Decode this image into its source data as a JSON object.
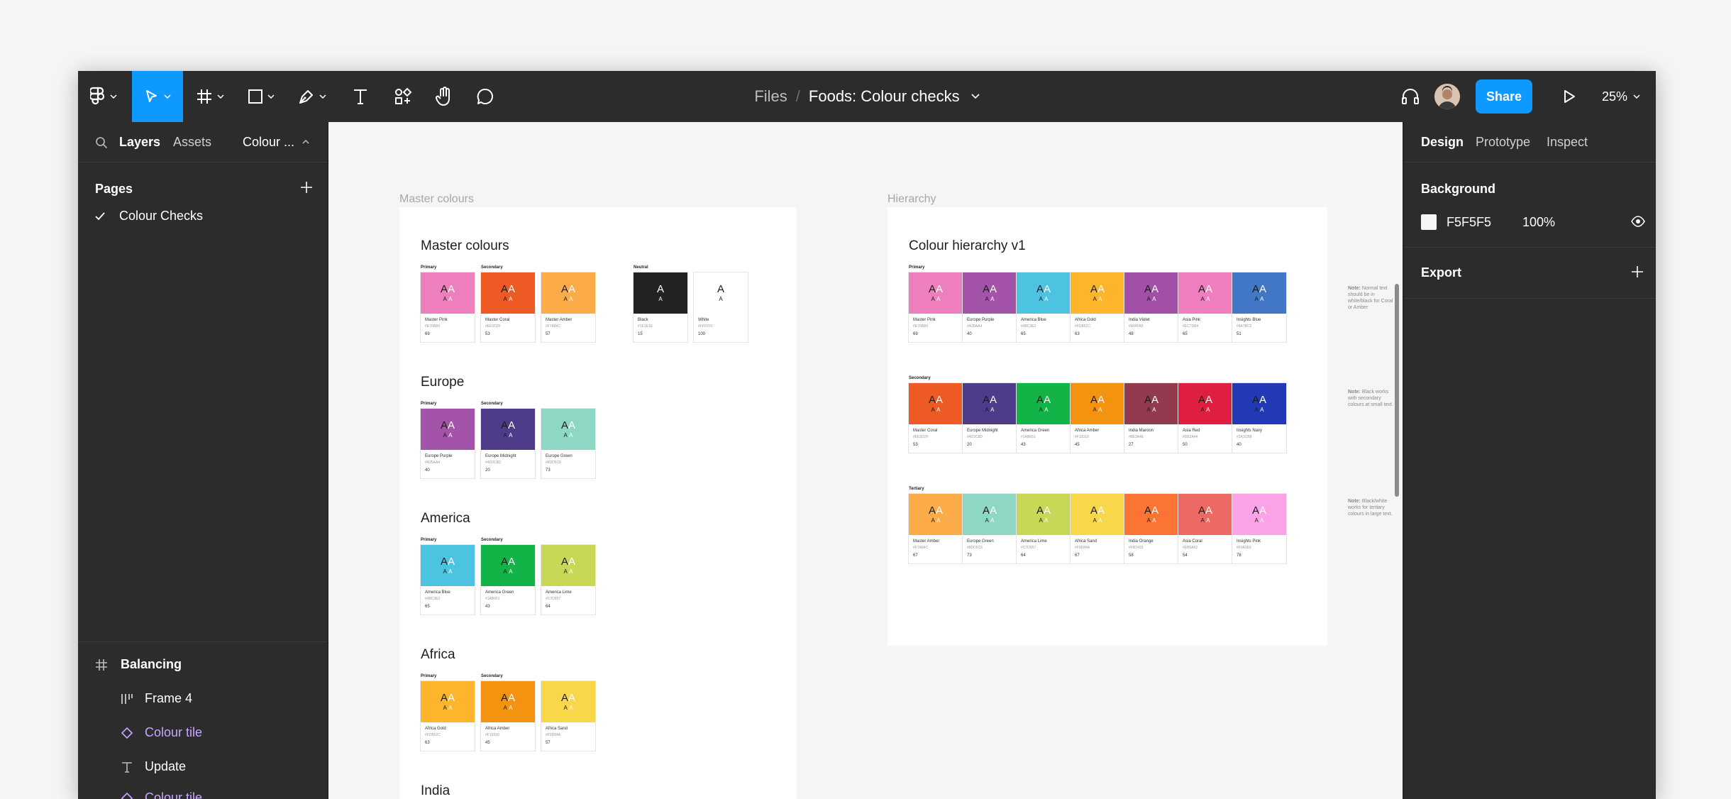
{
  "toolbar": {
    "breadcrumb_files": "Files",
    "breadcrumb_sep": "/",
    "file_name": "Foods: Colour checks",
    "share_label": "Share",
    "zoom": "25%"
  },
  "left_panel": {
    "tab_layers": "Layers",
    "tab_assets": "Assets",
    "page_selector": "Colour ...",
    "pages_header": "Pages",
    "pages": [
      "Colour Checks"
    ],
    "layers": [
      {
        "label": "Balancing",
        "kind": "frame"
      },
      {
        "label": "Frame 4",
        "kind": "autolayout"
      },
      {
        "label": "Colour tile",
        "kind": "component"
      },
      {
        "label": "Update",
        "kind": "text"
      },
      {
        "label": "Colour tile",
        "kind": "component"
      }
    ]
  },
  "right_panel": {
    "tab_design": "Design",
    "tab_prototype": "Prototype",
    "tab_inspect": "Inspect",
    "background_label": "Background",
    "background_hex": "F5F5F5",
    "background_opacity": "100%",
    "export_label": "Export"
  },
  "canvas": {
    "frame1_label": "Master colours",
    "frame2_label": "Hierarchy",
    "master": {
      "title": "Master colours",
      "primary_label": "Primary",
      "secondary_label": "Secondary",
      "neutral_label": "Neutral",
      "tiles": [
        {
          "name": "Master Pink",
          "hex": "#E76BB0",
          "score": "69",
          "color": "#ee7fbd"
        },
        {
          "name": "Master Coral",
          "hex": "#EE5D2F",
          "score": "53",
          "color": "#ee5a24"
        },
        {
          "name": "Master Amber",
          "hex": "#F7A84C",
          "score": "57",
          "color": "#fbab48"
        }
      ],
      "neutral": [
        {
          "name": "Black",
          "hex": "#1E1E1E",
          "score": "15",
          "color": "#222222",
          "a": "A"
        },
        {
          "name": "White",
          "hex": "#FFFFFF",
          "score": "100",
          "color": "#ffffff",
          "a": "A"
        }
      ]
    },
    "europe": {
      "title": "Europe",
      "primary_label": "Primary",
      "secondary_label": "Secondary",
      "tiles": [
        {
          "name": "Europe Purple",
          "hex": "#A35AA4",
          "score": "40",
          "color": "#a354a8"
        },
        {
          "name": "Europe Midnight",
          "hex": "#4D3C8D",
          "score": "20",
          "color": "#4e3b8a"
        },
        {
          "name": "Europe Green",
          "hex": "#8DD5C6",
          "score": "73",
          "color": "#8fd7c5"
        }
      ]
    },
    "america": {
      "title": "America",
      "primary_label": "Primary",
      "secondary_label": "Secondary",
      "tiles": [
        {
          "name": "America Blue",
          "hex": "#4BC3E2",
          "score": "65",
          "color": "#4cc4e1"
        },
        {
          "name": "America Green",
          "hex": "#1AB651",
          "score": "43",
          "color": "#12b447"
        },
        {
          "name": "America Lime",
          "hex": "#C7D957",
          "score": "64",
          "color": "#c8d856"
        }
      ]
    },
    "africa": {
      "title": "Africa",
      "primary_label": "Primary",
      "secondary_label": "Secondary",
      "tiles": [
        {
          "name": "Africa Gold",
          "hex": "#FDB52C",
          "score": "63",
          "color": "#fdb62c"
        },
        {
          "name": "Africa Amber",
          "hex": "#F19318",
          "score": "45",
          "color": "#f39310"
        },
        {
          "name": "Africa Sand",
          "hex": "#F9D84A",
          "score": "57",
          "color": "#f8d84a"
        }
      ]
    },
    "india": {
      "title": "India"
    },
    "hierarchy": {
      "title": "Colour hierarchy v1",
      "rows": [
        {
          "label": "Primary",
          "tiles": [
            {
              "name": "Master Pink",
              "hex": "#E76BB0",
              "score": "69",
              "color": "#ee7fbd"
            },
            {
              "name": "Europe Purple",
              "hex": "#A35AA4",
              "score": "40",
              "color": "#a354a8"
            },
            {
              "name": "America Blue",
              "hex": "#4BC3E2",
              "score": "65",
              "color": "#4cc4e1"
            },
            {
              "name": "Africa Gold",
              "hex": "#FDB52C",
              "score": "63",
              "color": "#fdb62c"
            },
            {
              "name": "India Violet",
              "hex": "#A04FA5",
              "score": "48",
              "color": "#a24fa8"
            },
            {
              "name": "Asia Pink",
              "hex": "#EC7DB4",
              "score": "65",
              "color": "#ee7ebd"
            },
            {
              "name": "Insights Blue",
              "hex": "#4A7BC2",
              "score": "51",
              "color": "#4277c5"
            }
          ]
        },
        {
          "label": "Secondary",
          "tiles": [
            {
              "name": "Master Coral",
              "hex": "#EE5D2F",
              "score": "53",
              "color": "#ee5a24"
            },
            {
              "name": "Europe Midnight",
              "hex": "#4D3C8D",
              "score": "20",
              "color": "#4e3b8a"
            },
            {
              "name": "America Green",
              "hex": "#1AB651",
              "score": "43",
              "color": "#12b447"
            },
            {
              "name": "Africa Amber",
              "hex": "#F19318",
              "score": "45",
              "color": "#f39310"
            },
            {
              "name": "India Maroon",
              "hex": "#8E3A4E",
              "score": "27",
              "color": "#923b4e"
            },
            {
              "name": "Asia Red",
              "hex": "#DE2A44",
              "score": "50",
              "color": "#df1f42"
            },
            {
              "name": "Insights Navy",
              "hex": "#2A3CB8",
              "score": "40",
              "color": "#2338b5"
            }
          ]
        },
        {
          "label": "Tertiary",
          "tiles": [
            {
              "name": "Master Amber",
              "hex": "#F7A84C",
              "score": "67",
              "color": "#fbab48"
            },
            {
              "name": "Europe Green",
              "hex": "#8DD5C6",
              "score": "73",
              "color": "#8fd7c5"
            },
            {
              "name": "America Lime",
              "hex": "#C7D957",
              "score": "64",
              "color": "#c8d856"
            },
            {
              "name": "Africa Sand",
              "hex": "#F9D84A",
              "score": "67",
              "color": "#f8d84a"
            },
            {
              "name": "India Orange",
              "hex": "#FB7433",
              "score": "58",
              "color": "#fb7433"
            },
            {
              "name": "Asia Coral",
              "hex": "#EB6A62",
              "score": "54",
              "color": "#ec6a63"
            },
            {
              "name": "Insights Pink",
              "hex": "#F9A2E6",
              "score": "78",
              "color": "#faa3e6"
            }
          ]
        }
      ]
    },
    "notes": [
      {
        "bold": "Note:",
        "text": "Normal text should be in white/black for Coral or Amber"
      },
      {
        "bold": "Note:",
        "text": "Black works with secondary colours at small text."
      },
      {
        "bold": "Note:",
        "text": "Black/white works for tertiary colours in large text."
      }
    ]
  }
}
